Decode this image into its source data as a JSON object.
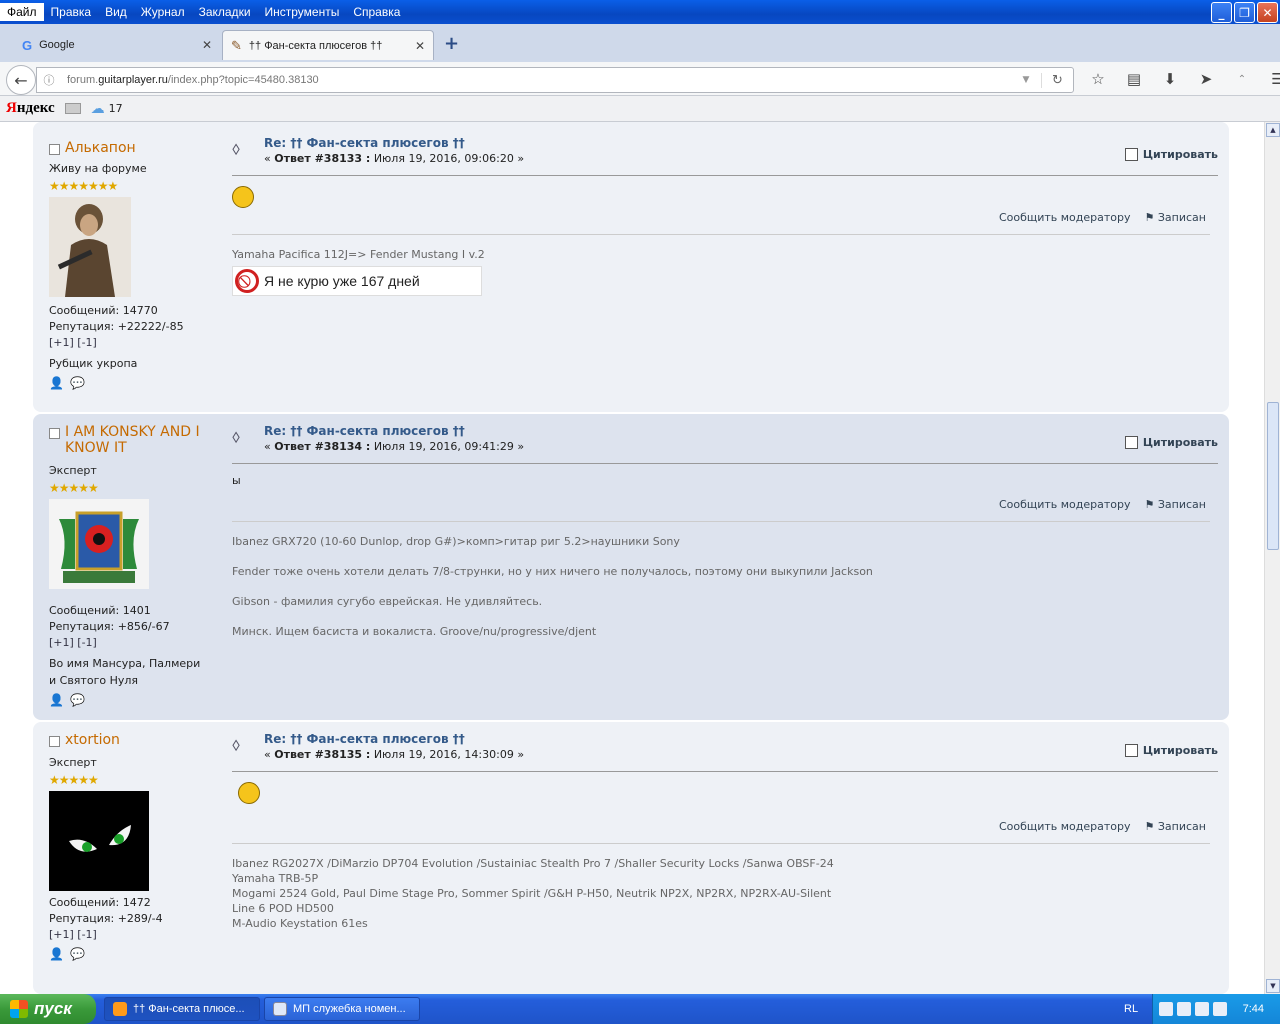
{
  "menu": [
    "Файл",
    "Правка",
    "Вид",
    "Журнал",
    "Закладки",
    "Инструменты",
    "Справка"
  ],
  "tabs": [
    {
      "title": "Google",
      "icon": "google-icon"
    },
    {
      "title": "†† Фан-секта плюсегов ††",
      "icon": "guitar-icon"
    }
  ],
  "url": {
    "prefix": "forum.",
    "domain": "guitarplayer.ru",
    "path": "/index.php?topic=45480.38130"
  },
  "bookmarks": {
    "yandex_ya": "Я",
    "yandex_rest": "ндекс",
    "weather_temp": "17"
  },
  "labels": {
    "quote": "Цитировать",
    "report": "Сообщить модератору",
    "logged": "Записан",
    "title_prefix": "Re: †† Фан-секта плюсегов ††"
  },
  "posts": [
    {
      "name": "Алькапон",
      "rank": "Живу на форуме",
      "stars": "★★★★★★★",
      "messages": "Сообщений: 14770",
      "reputation": "Репутация: +22222/-85",
      "karma": "[+1] [-1]",
      "personal": "Рубщик укропа",
      "answer": "Ответ #38133 :",
      "date": "Июля 19, 2016, 09:06:20",
      "body": "",
      "sig_line1": "Yamaha Pacifica 112J=> Fender Mustang I v.2",
      "nosmoke": "Я не курю уже 167 дней"
    },
    {
      "name": "I AM KONSKY AND I KNOW IT",
      "rank": "Эксперт",
      "stars": "★★★★★",
      "messages": "Сообщений: 1401",
      "reputation": "Репутация: +856/-67",
      "karma": "[+1] [-1]",
      "personal": "Во имя Мансура, Палмери и Святого Нуля",
      "answer": "Ответ #38134 :",
      "date": "Июля 19, 2016, 09:41:29",
      "body": "ы",
      "sig": [
        "Ibanez GRX720 (10-60 Dunlop, drop G#)>комп>гитар риг 5.2>наушники Sony",
        "Fender тоже очень хотели делать 7/8-струнки, но у них ничего не получалось, поэтому они выкупили Jackson",
        "Gibson - фамилия сугубо еврейская. Не удивляйтесь.",
        "Минск. Ищем басиста и вокалиста. Groove/nu/progressive/djent"
      ]
    },
    {
      "name": "xtortion",
      "rank": "Эксперт",
      "stars": "★★★★★",
      "messages": "Сообщений: 1472",
      "reputation": "Репутация: +289/-4",
      "karma": "[+1] [-1]",
      "answer": "Ответ #38135 :",
      "date": "Июля 19, 2016, 14:30:09",
      "body": "",
      "sig": [
        "Ibanez RG2027X /DiMarzio DP704 Evolution /Sustainiac Stealth Pro 7 /Shaller Security Locks /Sanwa OBSF-24",
        "Yamaha TRB-5P",
        "Mogami 2524 Gold, Paul Dime Stage Pro, Sommer Spirit /G&H P-H50, Neutrik NP2X, NP2RX, NP2RX-AU-Silent",
        "Line 6 POD HD500",
        "M-Audio Keystation 61es"
      ]
    }
  ],
  "taskbar": {
    "start": "пуск",
    "items": [
      "†† Фан-секта плюсе...",
      "МП служебка номен..."
    ],
    "lang": "RL",
    "clock": "7:44"
  }
}
